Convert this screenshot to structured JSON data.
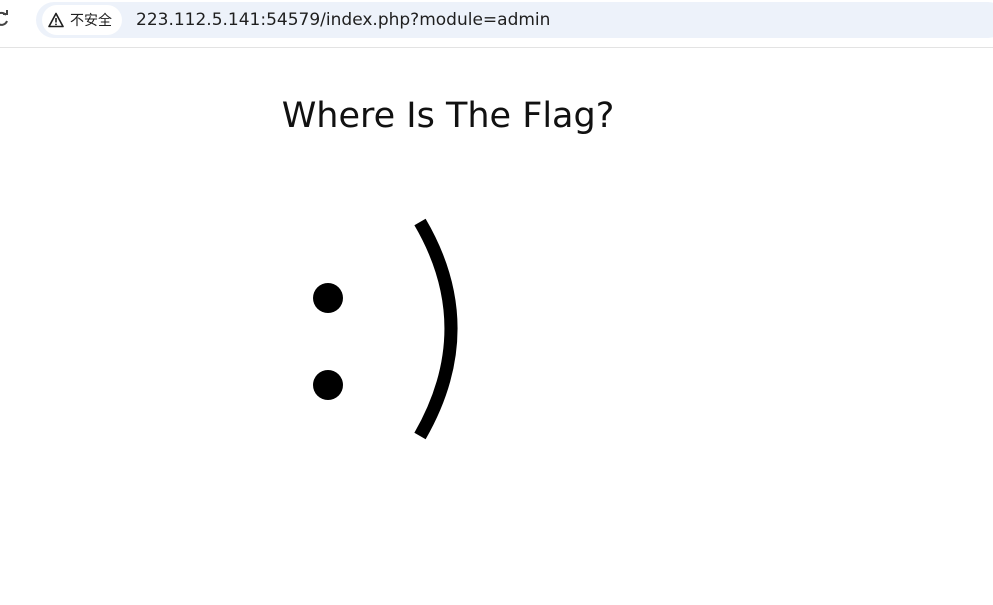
{
  "browser": {
    "security_label": "不安全",
    "url": "223.112.5.141:54579/index.php?module=admin"
  },
  "page": {
    "title": "Where Is The Flag?",
    "face_text": ":)"
  },
  "icons": {
    "reload": "reload-icon",
    "warning": "warning-icon"
  }
}
